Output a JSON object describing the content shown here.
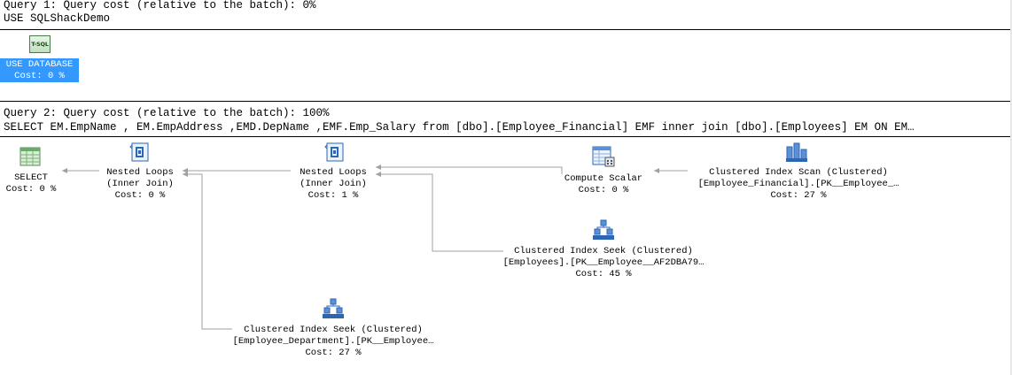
{
  "query1": {
    "header": "Query 1: Query cost (relative to the batch): 0%",
    "statement": "USE SQLShackDemo",
    "node": {
      "icon_text": "T-SQL",
      "label": "USE DATABASE",
      "cost": "Cost: 0 %"
    }
  },
  "query2": {
    "header": "Query 2: Query cost (relative to the batch): 100%",
    "statement": "SELECT EM.EmpName , EM.EmpAddress ,EMD.DepName ,EMF.Emp_Salary from [dbo].[Employee_Financial] EMF inner join [dbo].[Employees] EM ON EM…",
    "nodes": {
      "select": {
        "line1": "SELECT",
        "cost": "Cost: 0 %"
      },
      "nested_loops_1": {
        "line1": "Nested Loops",
        "line2": "(Inner Join)",
        "cost": "Cost: 0 %"
      },
      "nested_loops_2": {
        "line1": "Nested Loops",
        "line2": "(Inner Join)",
        "cost": "Cost: 1 %"
      },
      "compute_scalar": {
        "line1": "Compute Scalar",
        "cost": "Cost: 0 %"
      },
      "index_scan": {
        "line1": "Clustered Index Scan (Clustered)",
        "line2": "[Employee_Financial].[PK__Employee_…",
        "cost": "Cost: 27 %"
      },
      "index_seek_employees": {
        "line1": "Clustered Index Seek (Clustered)",
        "line2": "[Employees].[PK__Employee__AF2DBA79…",
        "cost": "Cost: 45 %"
      },
      "index_seek_department": {
        "line1": "Clustered Index Seek (Clustered)",
        "line2": "[Employee_Department].[PK__Employee…",
        "cost": "Cost: 27 %"
      }
    }
  },
  "colors": {
    "selected_bg": "#3399ff",
    "line": "#a0a0a0",
    "icon_blue": "#2b67b5"
  }
}
